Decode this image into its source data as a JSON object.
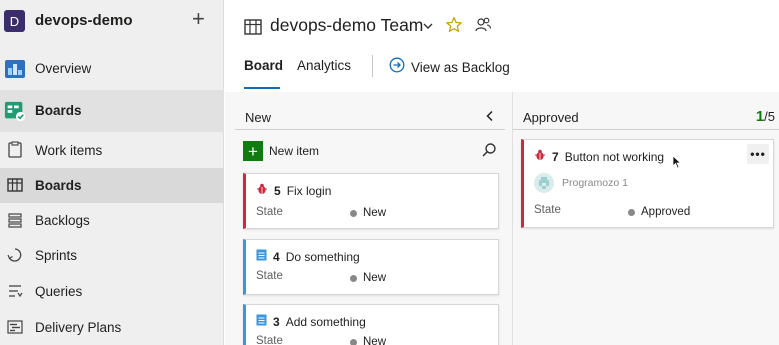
{
  "project": {
    "avatar_letter": "D",
    "name": "devops-demo",
    "add_symbol": "+"
  },
  "nav": {
    "overview": "Overview",
    "boards_hub": "Boards",
    "items": [
      {
        "label": "Work items",
        "icon": "work-items-icon"
      },
      {
        "label": "Boards",
        "icon": "boards-icon",
        "selected": true
      },
      {
        "label": "Backlogs",
        "icon": "backlogs-icon"
      },
      {
        "label": "Sprints",
        "icon": "sprints-icon"
      },
      {
        "label": "Queries",
        "icon": "queries-icon"
      },
      {
        "label": "Delivery Plans",
        "icon": "delivery-plans-icon"
      }
    ]
  },
  "header": {
    "team_title": "devops-demo Team",
    "tabs": [
      {
        "label": "Board",
        "active": true
      },
      {
        "label": "Analytics"
      }
    ],
    "view_as_backlog": "View as Backlog"
  },
  "board": {
    "columns": [
      {
        "title": "New",
        "new_item_label": "New item",
        "cards": [
          {
            "type": "bug",
            "id": "5",
            "title": "Fix login",
            "state_label": "State",
            "state": "New"
          },
          {
            "type": "task",
            "id": "4",
            "title": "Do something",
            "state_label": "State",
            "state": "New"
          },
          {
            "type": "task",
            "id": "3",
            "title": "Add something",
            "state_label": "State",
            "state": "New"
          }
        ]
      },
      {
        "title": "Approved",
        "count": "1",
        "limit": "/5",
        "cards": [
          {
            "type": "bug",
            "id": "7",
            "title": "Button not working",
            "assignee": "Programozo 1",
            "state_label": "State",
            "state": "Approved",
            "more": "•••"
          }
        ]
      }
    ]
  },
  "colors": {
    "accent": "#0f6cbd",
    "bug": "#cc293d",
    "task": "#3a96dd",
    "success": "#107c10"
  }
}
